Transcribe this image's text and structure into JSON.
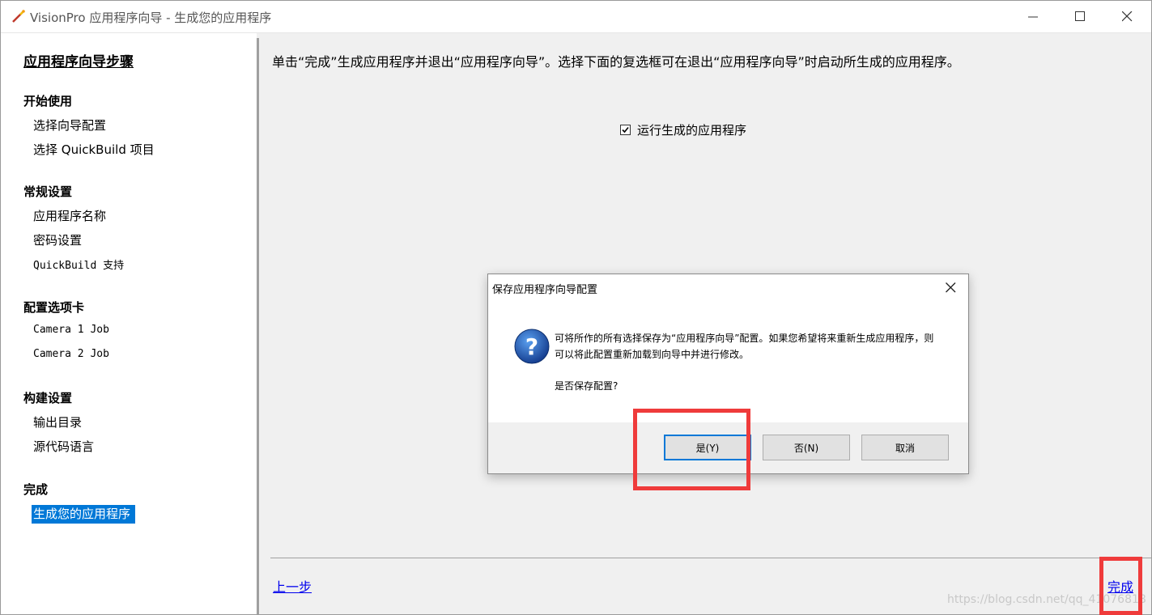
{
  "window": {
    "title": "VisionPro 应用程序向导 - 生成您的应用程序",
    "icon": "wand-icon"
  },
  "sidebar": {
    "heading": "应用程序向导步骤",
    "sections": [
      {
        "title": "开始使用",
        "items": [
          "选择向导配置",
          "选择 QuickBuild 项目"
        ]
      },
      {
        "title": "常规设置",
        "items": [
          "应用程序名称",
          "密码设置",
          "QuickBuild 支持"
        ]
      },
      {
        "title": "配置选项卡",
        "items": [
          "Camera 1 Job",
          "Camera 2 Job"
        ]
      },
      {
        "title": "构建设置",
        "items": [
          "输出目录",
          "源代码语言"
        ]
      },
      {
        "title": "完成",
        "items": [
          "生成您的应用程序"
        ]
      }
    ],
    "selected_item": "生成您的应用程序"
  },
  "main": {
    "instruction": "单击“完成”生成应用程序并退出“应用程序向导”。选择下面的复选框可在退出“应用程序向导”时启动所生成的应用程序。",
    "run_checkbox": {
      "label": "运行生成的应用程序",
      "checked": true
    },
    "prev_label": "上一步",
    "finish_label": "完成"
  },
  "dialog": {
    "title": "保存应用程序向导配置",
    "message": "可将所作的所有选择保存为“应用程序向导”配置。如果您希望将来重新生成应用程序，则可以将此配置重新加载到向导中并进行修改。",
    "question": "是否保存配置?",
    "buttons": {
      "yes": "是(Y)",
      "no": "否(N)",
      "cancel": "取消"
    },
    "icon": "question-icon"
  },
  "watermark": "https://blog.csdn.net/qq_41076818",
  "colors": {
    "accent": "#0078d7",
    "highlight": "#ef3b3b",
    "link": "#0000ee"
  }
}
